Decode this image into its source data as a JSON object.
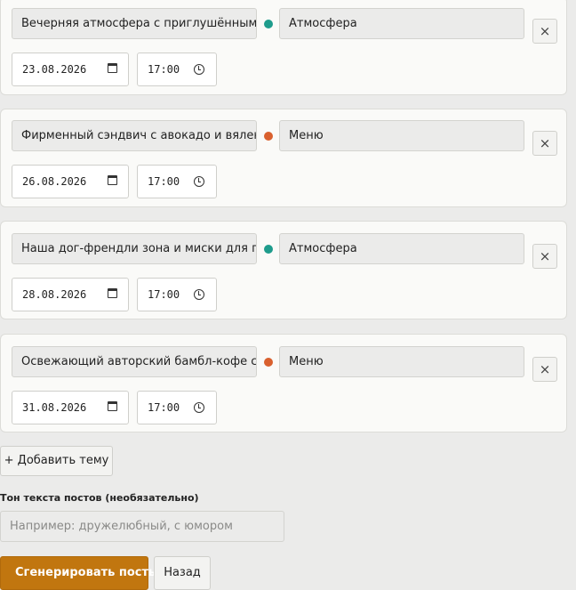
{
  "topics": [
    {
      "theme": "Вечерняя атмосфера с приглушённым светом",
      "category": "Атмосфера",
      "category_color": "#1e9c8c",
      "date": "23.08.2026",
      "time": "17:00"
    },
    {
      "theme": "Фирменный сэндвич с авокадо и вяленым",
      "category": "Меню",
      "category_color": "#d9602e",
      "date": "26.08.2026",
      "time": "17:00"
    },
    {
      "theme": "Наша дог-френдли зона и миски для питомцев",
      "category": "Атмосфера",
      "category_color": "#1e9c8c",
      "date": "28.08.2026",
      "time": "17:00"
    },
    {
      "theme": "Освежающий авторский бамбл-кофе с апельсином",
      "category": "Меню",
      "category_color": "#d9602e",
      "date": "31.08.2026",
      "time": "17:00"
    }
  ],
  "remove_symbol": "×",
  "add_topic_label": "+ Добавить тему",
  "tone": {
    "label": "Тон текста постов (необязательно)",
    "value": "",
    "placeholder": "Например: дружелюбный, с юмором"
  },
  "actions": {
    "generate_label": "Сгенерировать посты",
    "back_label": "Назад"
  },
  "colors": {
    "accent": "#c1760f",
    "atmosphere_dot": "#1e9c8c",
    "menu_dot": "#d9602e"
  }
}
